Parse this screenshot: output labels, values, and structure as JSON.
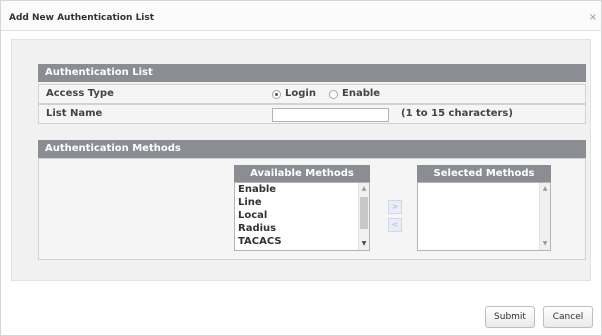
{
  "dialog": {
    "title": "Add New Authentication List",
    "close_glyph": "×"
  },
  "auth_list": {
    "header": "Authentication List",
    "access_type_label": "Access Type",
    "access_options": [
      {
        "label": "Login",
        "checked": true
      },
      {
        "label": "Enable",
        "checked": false
      }
    ],
    "list_name_label": "List Name",
    "list_name_value": "",
    "list_name_hint": "(1 to 15 characters)"
  },
  "auth_methods": {
    "header": "Authentication Methods",
    "available_header": "Available Methods",
    "available": [
      "Enable",
      "Line",
      "Local",
      "Radius",
      "TACACS"
    ],
    "selected_header": "Selected Methods",
    "selected": [],
    "add_glyph": ">",
    "remove_glyph": "<"
  },
  "footer": {
    "submit_label": "Submit",
    "cancel_label": "Cancel"
  }
}
